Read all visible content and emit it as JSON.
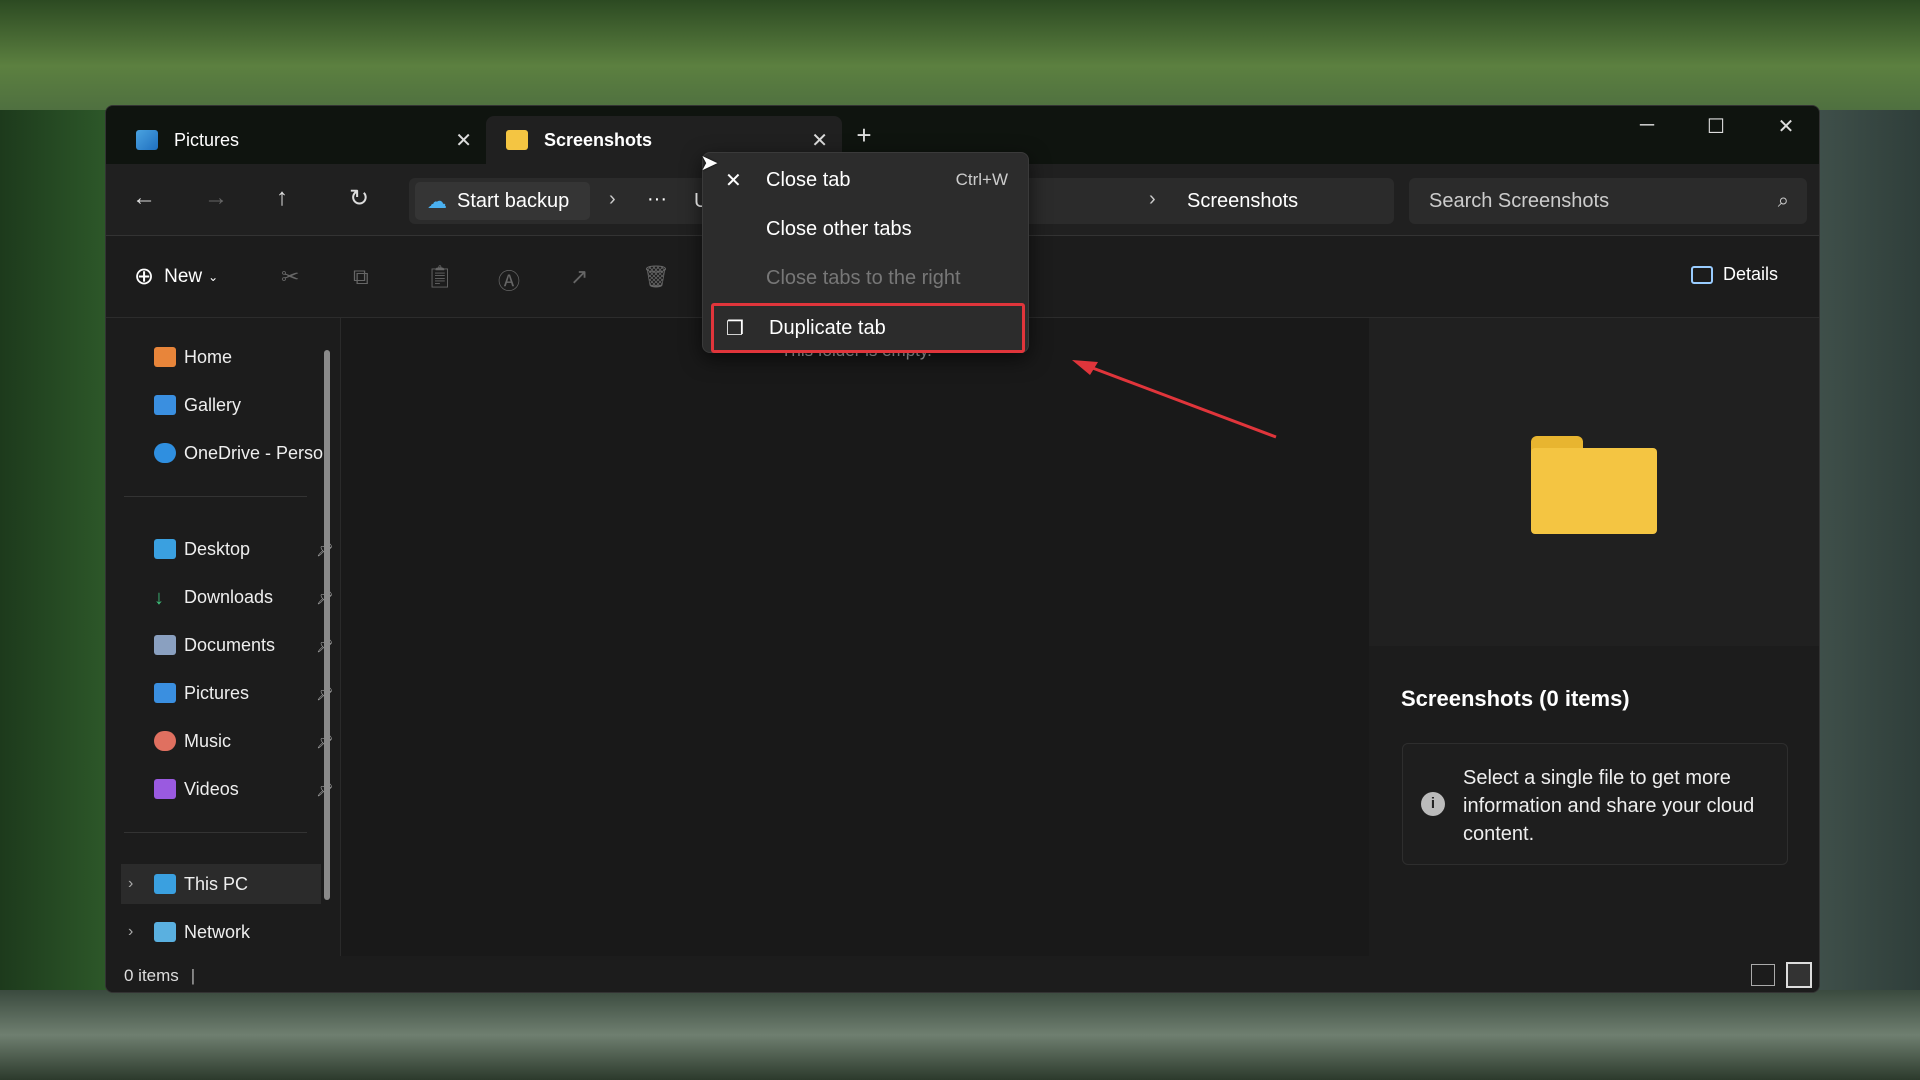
{
  "tabs": [
    {
      "label": "Pictures",
      "icon": "pictures-icon"
    },
    {
      "label": "Screenshots",
      "icon": "folder-icon",
      "active": true
    }
  ],
  "nav": {
    "backup": "Start backup",
    "ellipsis": "···",
    "partial": "U",
    "crumb": "Screenshots",
    "search_placeholder": "Search Screenshots"
  },
  "cmd": {
    "new": "New",
    "details": "Details"
  },
  "sidebar": {
    "items": [
      {
        "label": "Home"
      },
      {
        "label": "Gallery"
      },
      {
        "label": "OneDrive - Perso"
      },
      {
        "label": "Desktop"
      },
      {
        "label": "Downloads"
      },
      {
        "label": "Documents"
      },
      {
        "label": "Pictures"
      },
      {
        "label": "Music"
      },
      {
        "label": "Videos"
      },
      {
        "label": "This PC"
      },
      {
        "label": "Network"
      }
    ]
  },
  "main": {
    "empty": "This folder is empty."
  },
  "details": {
    "title": "Screenshots (0 items)",
    "info": "Select a single file to get more information and share your cloud content."
  },
  "status": {
    "items": "0 items"
  },
  "context_menu": {
    "items": [
      {
        "label": "Close tab",
        "shortcut": "Ctrl+W"
      },
      {
        "label": "Close other tabs"
      },
      {
        "label": "Close tabs to the right",
        "disabled": true
      },
      {
        "label": "Duplicate tab",
        "highlighted": true
      }
    ]
  },
  "colors": {
    "highlight": "#e0353b",
    "annotation_arrow": "#e0353b",
    "folder": "#f4c542"
  }
}
